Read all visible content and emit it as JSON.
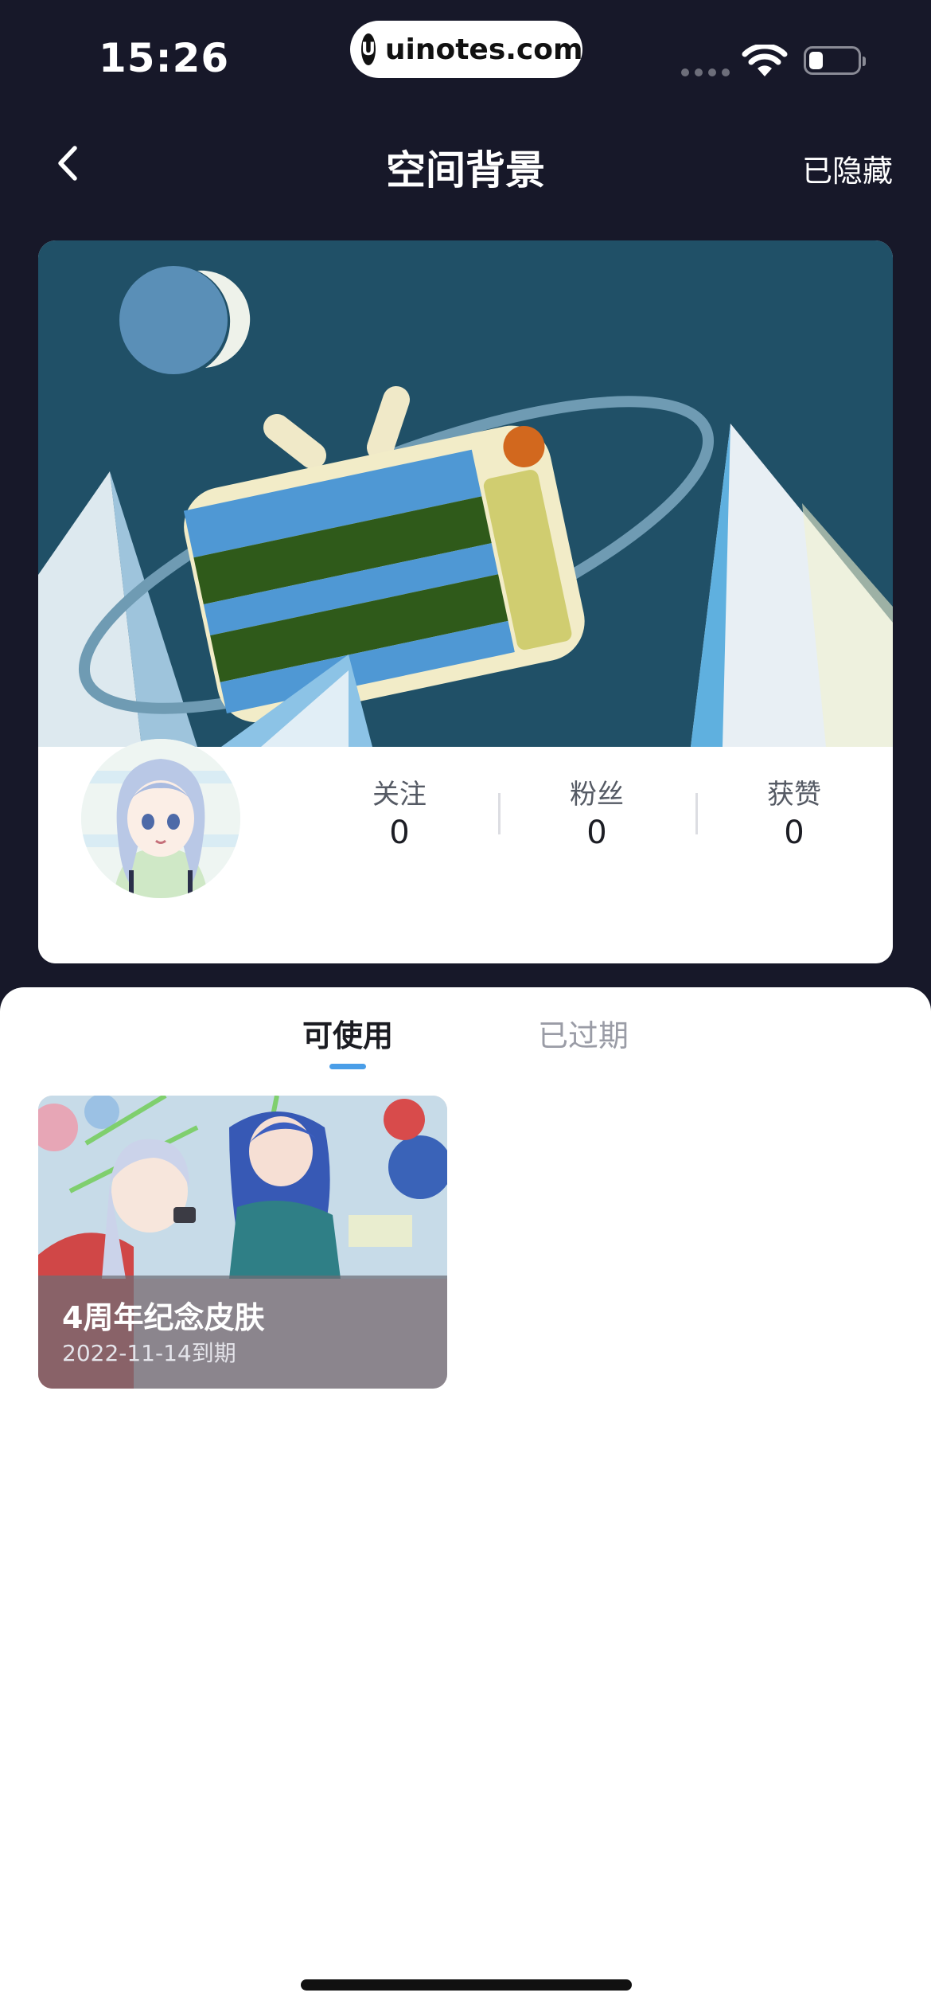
{
  "status_bar": {
    "time": "15:26",
    "url_logo": "U",
    "url": "uinotes.com",
    "battery_level": 0.3
  },
  "nav": {
    "title": "空间背景",
    "action": "已隐藏"
  },
  "profile": {
    "stats": [
      {
        "label": "关注",
        "value": "0"
      },
      {
        "label": "粉丝",
        "value": "0"
      },
      {
        "label": "获赞",
        "value": "0"
      }
    ]
  },
  "tabs": [
    {
      "label": "可使用",
      "active": true
    },
    {
      "label": "已过期",
      "active": false
    }
  ],
  "skins": [
    {
      "title": "4周年纪念皮肤",
      "expiry": "2022-11-14到期"
    }
  ],
  "colors": {
    "background": "#171829",
    "accent": "#4a9ee8"
  },
  "icons": {
    "back": "chevron-left-icon",
    "wifi": "wifi-icon",
    "battery": "battery-icon"
  }
}
